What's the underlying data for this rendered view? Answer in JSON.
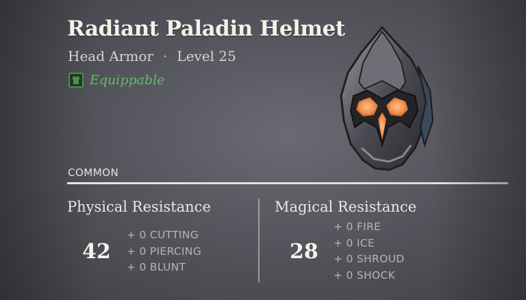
{
  "item": {
    "name": "Radiant Paladin Helmet",
    "type": "Head Armor",
    "separator": "·",
    "level": "Level 25",
    "equip_status": "Equippable",
    "rarity": "COMMON",
    "image_icon": "helmet-icon"
  },
  "colors": {
    "equippable_green": "#69b86a",
    "accent_orange": "#f08c48"
  },
  "physical": {
    "title": "Physical Resistance",
    "value": "42",
    "subs": [
      "+ 0 CUTTING",
      "+ 0 PIERCING",
      "+ 0 BLUNT"
    ]
  },
  "magical": {
    "title": "Magical Resistance",
    "value": "28",
    "subs": [
      "+ 0 FIRE",
      "+ 0 ICE",
      "+ 0 SHROUD",
      "+ 0 SHOCK"
    ]
  }
}
